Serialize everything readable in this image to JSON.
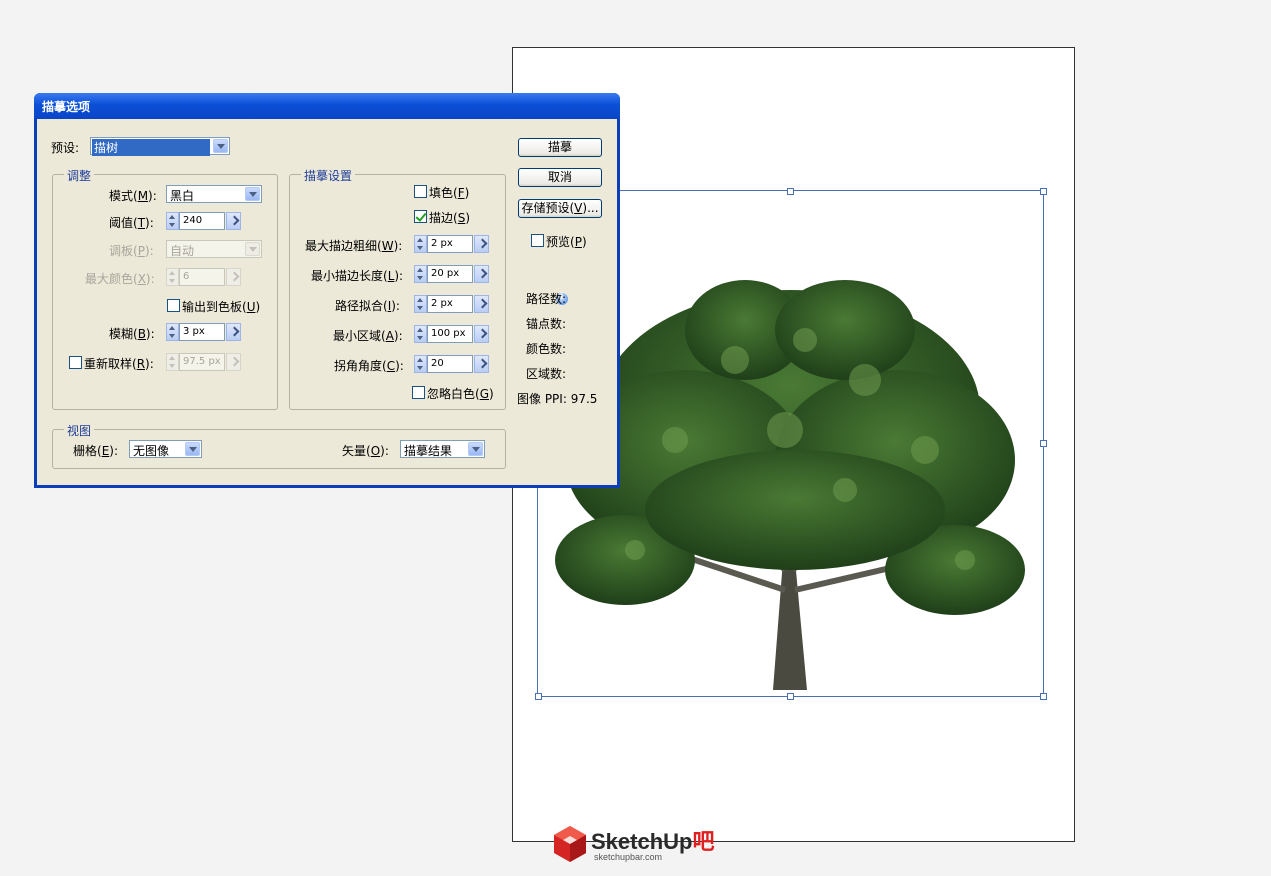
{
  "dialog": {
    "title": "描摹选项",
    "preset": {
      "label_main": "预设",
      "label_suffix": ":",
      "value": "描树"
    },
    "adjust": {
      "title": "调整",
      "mode": {
        "label": "模式(",
        "key": "M",
        "suffix": "):",
        "value": "黑白"
      },
      "threshold": {
        "label": "阈值(",
        "key": "T",
        "suffix": "):",
        "value": "240"
      },
      "palette": {
        "label": "调板(",
        "key": "P",
        "suffix": "):",
        "value": "自动"
      },
      "max_colors": {
        "label": "最大颜色(",
        "key": "X",
        "suffix": "):",
        "value": "6"
      },
      "output_swatches": {
        "label": "输出到色板(",
        "key": "U",
        "suffix": ")",
        "checked": false
      },
      "blur": {
        "label": "模糊(",
        "key": "B",
        "suffix": "):",
        "value": "3 px"
      },
      "resample": {
        "label": "重新取样(",
        "key": "R",
        "suffix": "):",
        "value": "97.5 px",
        "checked": false
      }
    },
    "trace": {
      "title": "描摹设置",
      "fill": {
        "label": "填色(",
        "key": "F",
        "suffix": ")",
        "checked": false
      },
      "stroke": {
        "label": "描边(",
        "key": "S",
        "suffix": ")",
        "checked": true
      },
      "max_stroke_weight": {
        "label": "最大描边粗细(",
        "key": "W",
        "suffix": "):",
        "value": "2 px"
      },
      "min_stroke_length": {
        "label": "最小描边长度(",
        "key": "L",
        "suffix": "):",
        "value": "20 px"
      },
      "path_fitting": {
        "label": "路径拟合(",
        "key": "I",
        "suffix": "):",
        "value": "2 px"
      },
      "min_area": {
        "label": "最小区域(",
        "key": "A",
        "suffix": "):",
        "value": "100 px"
      },
      "corner_angle": {
        "label": "拐角角度(",
        "key": "C",
        "suffix": "):",
        "value": "20"
      },
      "ignore_white": {
        "label": "忽略白色(",
        "key": "G",
        "suffix": ")",
        "checked": false
      }
    },
    "view": {
      "title": "视图",
      "raster": {
        "label": "栅格(",
        "key": "E",
        "suffix": "):",
        "value": "无图像"
      },
      "vector": {
        "label": "矢量(",
        "key": "O",
        "suffix": "):",
        "value": "描摹结果"
      }
    },
    "buttons": {
      "trace": "描摹",
      "cancel": "取消",
      "save_preset_prefix": "存储预设(",
      "save_preset_key": "V",
      "save_preset_suffix": ")..."
    },
    "preview": {
      "label": "预览(",
      "key": "P",
      "suffix": ")",
      "checked": false
    },
    "stats": {
      "paths": "路径数:",
      "anchors": "锚点数:",
      "colors": "颜色数:",
      "areas": "区域数:",
      "ppi_label": "图像 PPI:",
      "ppi_value": "97.5"
    }
  },
  "watermark": {
    "brand_main": "SketchUp",
    "brand_suffix": "吧",
    "site": "sketchupbar.com"
  },
  "icons": {
    "info": "info-icon",
    "dropdown": "chevron-down-icon",
    "next": "chevron-right-icon",
    "logo": "sketchup-cube-logo"
  },
  "colors": {
    "title_bar": "#0b4fd6",
    "dialog_bg": "#ece9d8",
    "group_title": "#1e3d9a",
    "selection_box": "#4a6fb5",
    "tree_foliage": "#2f5a24"
  }
}
